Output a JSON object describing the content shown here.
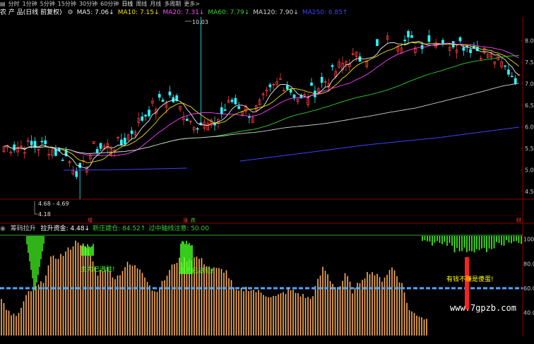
{
  "toolbar": {
    "items": [
      "分时",
      "1分钟",
      "5分钟",
      "15分钟",
      "30分钟",
      "60分钟",
      "日线",
      "周线",
      "月线",
      "多周期",
      "更多>"
    ],
    "active": "日线"
  },
  "colors": {
    "bg": "#000000",
    "up": "#ff3c3c",
    "down": "#29f7ff",
    "ma5": "#f0f0f0",
    "ma10": "#f0e000",
    "ma20": "#ff44ff",
    "ma60": "#30d030",
    "ma120": "#d0d0d0",
    "ma250": "#4040ff",
    "grid": "#8b0000",
    "hist": "#ffb060",
    "green": "#44ff22",
    "redbar": "#ff2020",
    "dashline": "#4da6ff"
  },
  "main": {
    "stock_name": "农 产 品(日线 前复权)",
    "ma": [
      {
        "label": "MA5: 7.06",
        "arrow": "↓",
        "color": "#f0f0f0"
      },
      {
        "label": "MA10: 7.15",
        "arrow": "↓",
        "color": "#f0e000"
      },
      {
        "label": "MA20: 7.31",
        "arrow": "↓",
        "color": "#ff44ff"
      },
      {
        "label": "MA60: 7.79",
        "arrow": "↓",
        "color": "#30d030"
      },
      {
        "label": "MA120: 7.90",
        "arrow": "↓",
        "color": "#d0d0d0"
      },
      {
        "label": "MA250: 6.85",
        "arrow": "↑",
        "color": "#4040ff"
      }
    ],
    "y_ticks": [
      "8.0",
      "7.5",
      "7.0",
      "6.5",
      "6.0",
      "5.5",
      "5.0",
      "4.5"
    ],
    "high_label": "10.03",
    "low_label": "4.18",
    "range_label": "4.68 - 4.69",
    "markers": [
      {
        "text": "增",
        "color": "#ff3c3c"
      },
      {
        "text": "涨",
        "color": "#ff3c3c"
      },
      {
        "text": "跌",
        "color": "#30d030"
      },
      {
        "text": "财",
        "color": "#ff3c3c"
      }
    ]
  },
  "indicator": {
    "name": "筹码拉升",
    "items": [
      {
        "label": "拉升资金: 4.48",
        "arrow": "↓",
        "color": "#ffffff"
      },
      {
        "label": "新庄建仓: 84.52",
        "arrow": "↑",
        "color": "#30d030"
      },
      {
        "label": "过中轴线注意: 50.00",
        "arrow": "",
        "color": "#30d030"
      }
    ],
    "y_ticks": [
      "100",
      "80.0",
      "60.0",
      "40.0"
    ],
    "annotations": [
      "主力已进驻!",
      "有钱不赚是傻蛋!"
    ]
  },
  "watermark": "www.7gpzb.com"
}
